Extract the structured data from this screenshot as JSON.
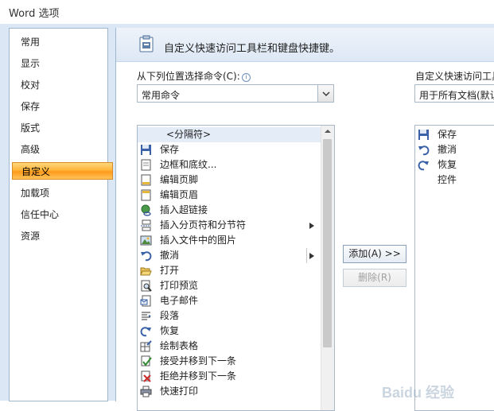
{
  "window": {
    "title": "Word 选项"
  },
  "sidebar": {
    "items": [
      {
        "label": "常用"
      },
      {
        "label": "显示"
      },
      {
        "label": "校对"
      },
      {
        "label": "保存"
      },
      {
        "label": "版式"
      },
      {
        "label": "高级"
      },
      {
        "label": "自定义",
        "selected": true
      },
      {
        "label": "加载项"
      },
      {
        "label": "信任中心"
      },
      {
        "label": "资源"
      }
    ]
  },
  "main": {
    "header": "自定义快速访问工具栏和键盘快捷键。",
    "choose_label": "从下列位置选择命令(C):",
    "choose_value": "常用命令",
    "target_label": "自定义快速访问工具栏",
    "target_value": "用于所有文档(默认",
    "commands": [
      {
        "label": "<分隔符>",
        "icon": "none"
      },
      {
        "label": "保存",
        "icon": "save-icon"
      },
      {
        "label": "边框和底纹...",
        "icon": "page-icon"
      },
      {
        "label": "编辑页脚",
        "icon": "page-icon"
      },
      {
        "label": "编辑页眉",
        "icon": "page-icon"
      },
      {
        "label": "插入超链接",
        "icon": "globe-link-icon"
      },
      {
        "label": "插入分页符和分节符",
        "icon": "page-break-icon",
        "submenu": true
      },
      {
        "label": "插入文件中的图片",
        "icon": "picture-icon"
      },
      {
        "label": "撤消",
        "icon": "undo-icon",
        "submenu": true
      },
      {
        "label": "打开",
        "icon": "folder-icon"
      },
      {
        "label": "打印预览",
        "icon": "print-preview-icon"
      },
      {
        "label": "电子邮件",
        "icon": "email-icon"
      },
      {
        "label": "段落",
        "icon": "paragraph-icon"
      },
      {
        "label": "恢复",
        "icon": "redo-icon"
      },
      {
        "label": "绘制表格",
        "icon": "draw-table-icon"
      },
      {
        "label": "接受并移到下一条",
        "icon": "accept-icon"
      },
      {
        "label": "拒绝并移到下一条",
        "icon": "reject-icon"
      },
      {
        "label": "快速打印",
        "icon": "printer-icon"
      }
    ],
    "add_button": "添加(A) >>",
    "remove_button": "删除(R)",
    "toolbar_items": [
      {
        "label": "保存",
        "icon": "save-icon"
      },
      {
        "label": "撤消",
        "icon": "undo-icon"
      },
      {
        "label": "恢复",
        "icon": "redo-icon"
      },
      {
        "label": "控件",
        "icon": "none"
      }
    ]
  },
  "watermark": {
    "text": "Baidu 经验"
  },
  "colors": {
    "accent": "#ffb53a",
    "frame": "#dbe7f4",
    "border": "#9fb6cf"
  }
}
